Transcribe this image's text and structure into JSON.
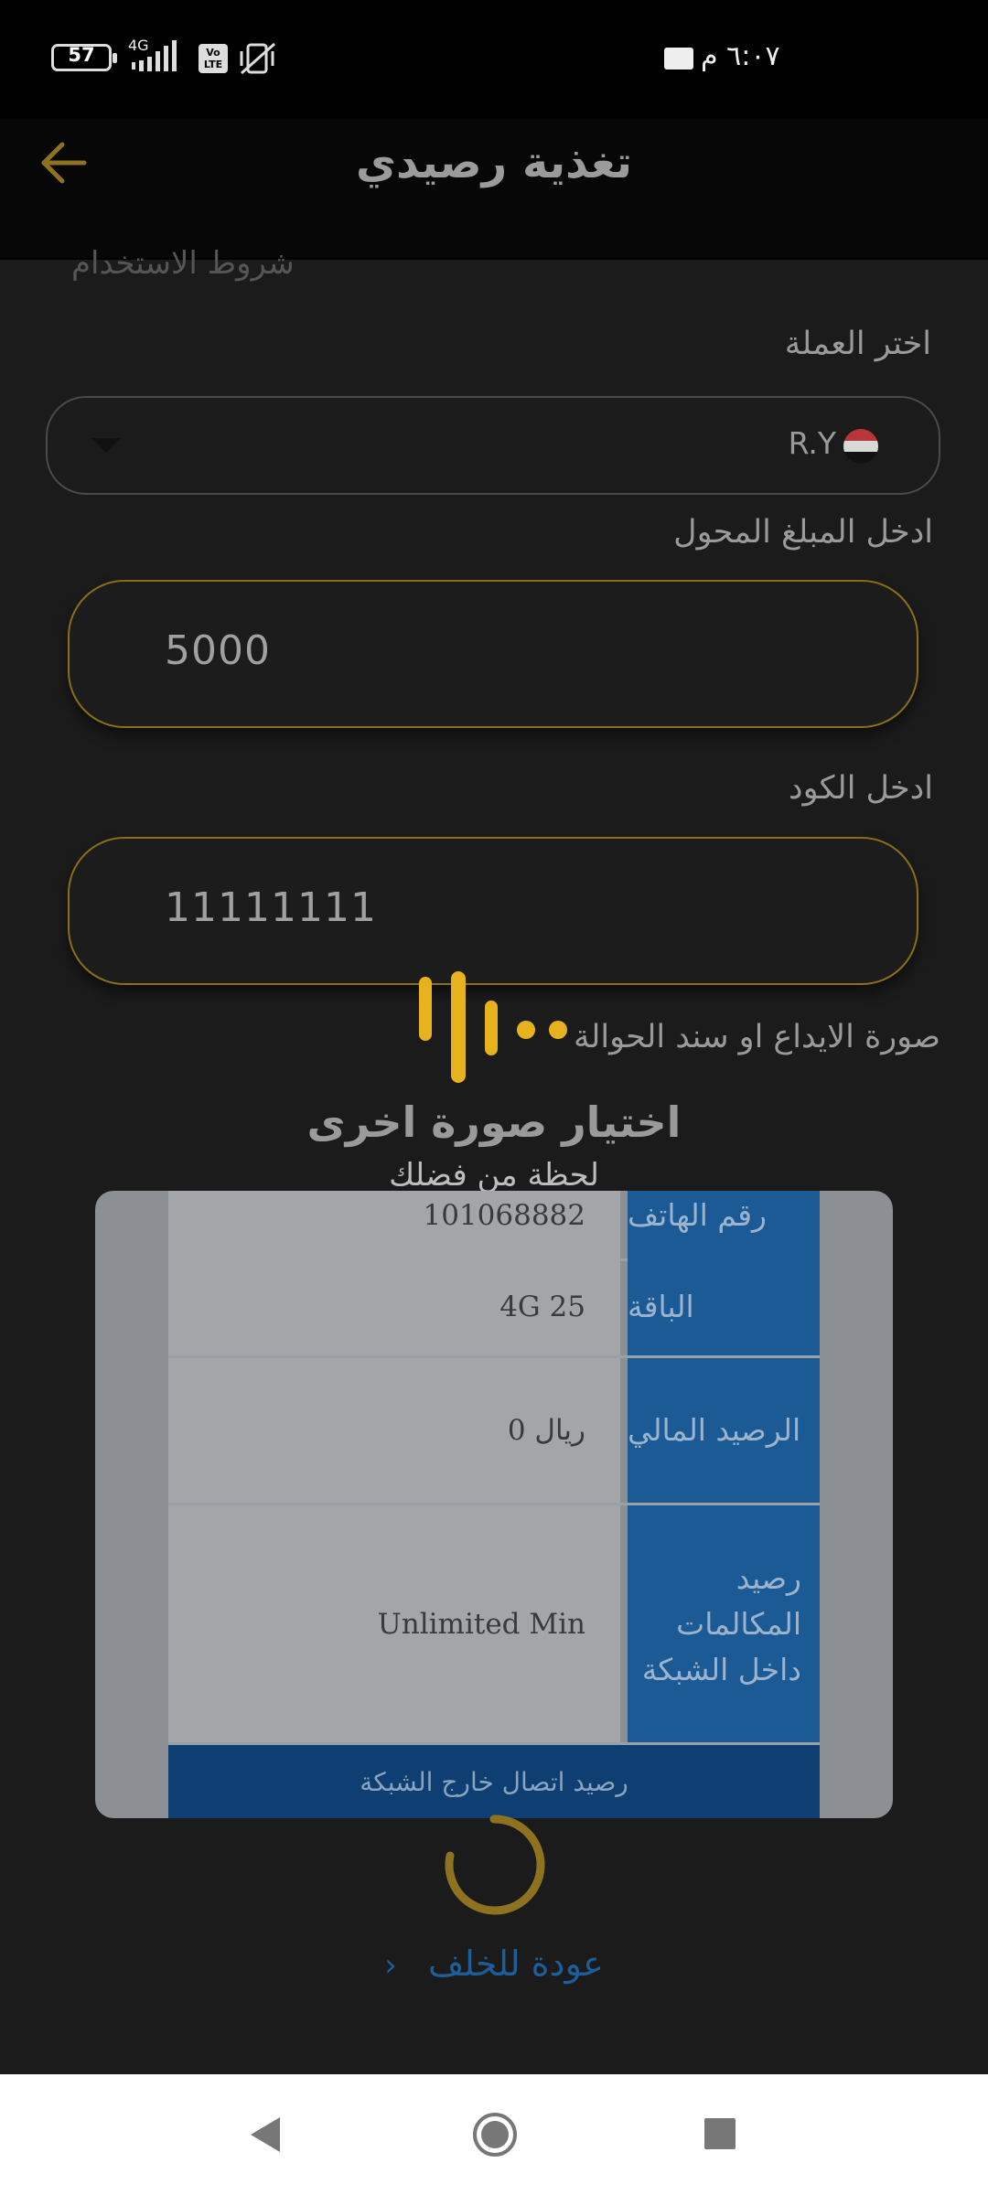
{
  "status_bar": {
    "time": "٦:٠٧ م",
    "battery": "57",
    "network": "4G",
    "volte": "Vo LTE",
    "icons": [
      "battery-icon",
      "signal-icon",
      "volte-icon",
      "vibrate-off-icon",
      "notification-icon"
    ]
  },
  "app_bar": {
    "title": "تغذية رصيدي",
    "back_icon": "arrow-left-icon"
  },
  "form": {
    "terms_text": "شروط الاستخدام",
    "currency_label": "اختر العملة",
    "currency_value": "R.Y",
    "amount_label": "ادخل المبلغ المحول",
    "amount_value": "5000",
    "code_label": "ادخل الكود",
    "code_value": "11111111",
    "receipt_label": "صورة الايداع او سند الحوالة",
    "choose_other_image": "اختيار صورة اخرى",
    "wait_text": "لحظة من فضلك"
  },
  "receipt_image": {
    "rows": [
      {
        "key": "رقم الهاتف",
        "value": "101068882"
      },
      {
        "key": "الباقة",
        "value": "4G 25"
      },
      {
        "key": "الرصيد المالي",
        "value": "0 ريال"
      },
      {
        "key": "رصيد المكالمات داخل الشبكة",
        "value": "Unlimited Min"
      }
    ],
    "footer": "رصيد اتصال خارج الشبكة"
  },
  "back_link": {
    "label": "عودة للخلف",
    "icon": "chevron-left-icon"
  },
  "colors": {
    "accent": "#E6B31E",
    "background": "#1B1B1B",
    "link": "#1D5D9A"
  }
}
